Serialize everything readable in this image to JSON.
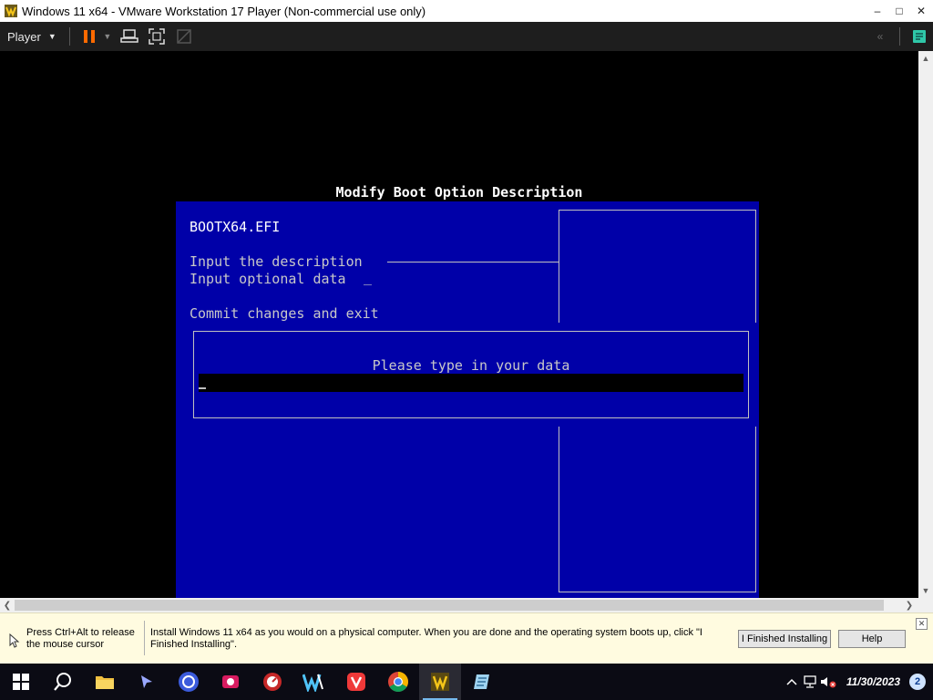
{
  "window": {
    "title": "Windows 11 x64 - VMware Workstation 17 Player (Non-commercial use only)",
    "minimize": "–",
    "maximize": "□",
    "close": "✕"
  },
  "toolbar": {
    "player_label": "Player",
    "accent_pause": "#ff6a00"
  },
  "bios": {
    "header": "Modify Boot Option Description",
    "file_name": "BOOTX64.EFI",
    "input_description_label": "Input the description",
    "input_optional_label": "Input optional data",
    "optional_value": "_",
    "commit_label": "Commit changes and exit",
    "popup_prompt": "Please type in your data",
    "panel_color": "#0000a8"
  },
  "notification": {
    "release_text": "Press Ctrl+Alt to release the mouse cursor",
    "install_text": "Install Windows 11 x64 as you would on a physical computer. When you are done and the operating system boots up, click \"I Finished Installing\".",
    "finished_button": "I Finished Installing",
    "help_button": "Help"
  },
  "taskbar": {
    "items": [
      "start-icon",
      "search-icon",
      "file-explorer-icon",
      "pointer-app-icon",
      "vm-app-icon",
      "camera-app-icon",
      "gauge-app-icon",
      "w-app-icon",
      "vivaldi-icon",
      "chrome-icon",
      "vmware-icon",
      "notepad-icon"
    ],
    "date": "11/30/2023",
    "notification_count": "2"
  }
}
